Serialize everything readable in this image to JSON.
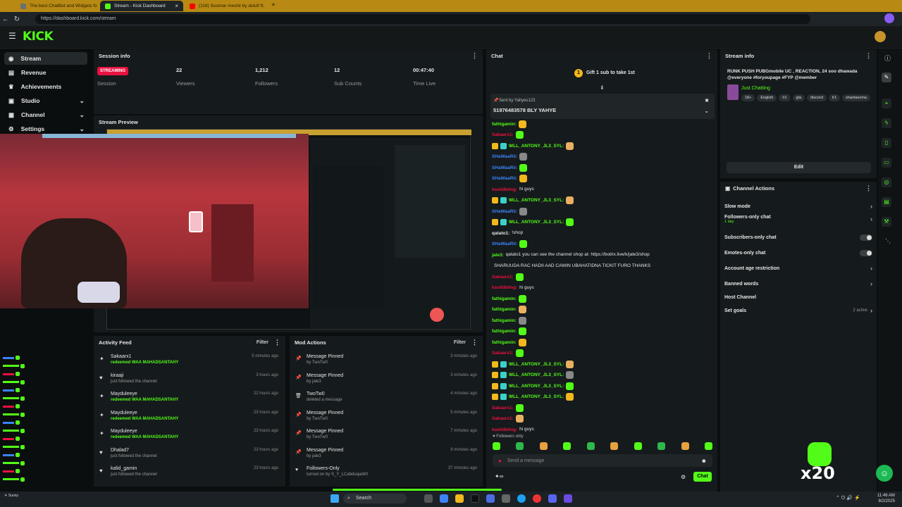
{
  "browser": {
    "tabs": [
      {
        "label": "The best ChatBot and Widgets fo",
        "color": "#6a6f73"
      },
      {
        "label": "Stream - Kick Dashboard",
        "color": "#53fc18"
      },
      {
        "label": "(118) Soomar meshii by dulufi ft.",
        "color": "#ff0000"
      }
    ],
    "url": "https://dashboard.kick.com/stream"
  },
  "app": {
    "logo": "KICK"
  },
  "sidebar": {
    "items": [
      {
        "label": "Stream",
        "icon": "radio-icon"
      },
      {
        "label": "Revenue",
        "icon": "money-icon"
      },
      {
        "label": "Achievements",
        "icon": "trophy-icon"
      },
      {
        "label": "Studio",
        "icon": "studio-icon"
      },
      {
        "label": "Channel",
        "icon": "channel-icon"
      },
      {
        "label": "Settings",
        "icon": "gear-icon"
      }
    ]
  },
  "session": {
    "title": "Session info",
    "status": "STREAMING",
    "status_label": "Session",
    "viewers": "22",
    "viewers_label": "Viewers",
    "followers": "1,212",
    "followers_label": "Followers",
    "subs": "12",
    "subs_label": "Sub Counts",
    "time": "00:47:40",
    "time_label": "Time Live"
  },
  "preview": {
    "title": "Stream Preview"
  },
  "activity": {
    "title": "Activity Feed",
    "filter": "Filter",
    "items": [
      {
        "name": "Sakaarx1",
        "detail": "redeemed WAA MAHADSANTAHY",
        "time": "5 minutes ago",
        "green": true,
        "icon": "gift"
      },
      {
        "name": "kiraaji",
        "detail": "just followed the channel",
        "time": "3 hours ago",
        "green": false,
        "icon": "heart"
      },
      {
        "name": "Mayduleeye",
        "detail": "redeemed WAA MAHADSANTAHY",
        "time": "22 hours ago",
        "green": true,
        "icon": "gift"
      },
      {
        "name": "Mayduleeye",
        "detail": "redeemed WAA MAHADSANTAHY",
        "time": "23 hours ago",
        "green": true,
        "icon": "gift"
      },
      {
        "name": "Mayduleeye",
        "detail": "redeemed WAA MAHADSANTAHY",
        "time": "23 hours ago",
        "green": true,
        "icon": "gift"
      },
      {
        "name": "Dhalad7",
        "detail": "just followed the channel",
        "time": "23 hours ago",
        "green": false,
        "icon": "heart"
      },
      {
        "name": "kalid_gamin",
        "detail": "just followed the channel",
        "time": "23 hours ago",
        "green": false,
        "icon": "heart"
      }
    ]
  },
  "mod": {
    "title": "Mod Actions",
    "filter": "Filter",
    "items": [
      {
        "name": "Message Pinned",
        "detail": "by TwoTw0",
        "time": "3 minutes ago",
        "icon": "pin"
      },
      {
        "name": "Message Pinned",
        "detail": "by jale3",
        "time": "3 minutes ago",
        "icon": "pin"
      },
      {
        "name": "TwoTw0",
        "detail": "deleted a message",
        "time": "4 minutes ago",
        "icon": "trash"
      },
      {
        "name": "Message Pinned",
        "detail": "by TwoTw0",
        "time": "5 minutes ago",
        "icon": "pin"
      },
      {
        "name": "Message Pinned",
        "detail": "by TwoTw0",
        "time": "7 minutes ago",
        "icon": "pin"
      },
      {
        "name": "Message Pinned",
        "detail": "by jale3",
        "time": "9 minutes ago",
        "icon": "pin"
      },
      {
        "name": "Followers-Only",
        "detail": "turned on by S_Y_LCabduqadir0",
        "time": "37 minutes ago",
        "icon": "heart"
      }
    ]
  },
  "chat": {
    "title": "Chat",
    "gift_banner": "Gift 1 sub to take 1st",
    "pinned_by": "Sent by Yahyes123",
    "pinned_msg": "51976483578 BLY YAHYE",
    "followers_only": "Followers only",
    "placeholder": "Send a message",
    "send_label": "Chat",
    "messages": [
      {
        "user": "fathigamin:",
        "color": "#53fc18",
        "text": ""
      },
      {
        "user": "Sakaarx1:",
        "color": "#e8113f",
        "text": ""
      },
      {
        "user": "WLL_ANTONY_JL3_SYL:",
        "color": "#53fc18",
        "text": ""
      },
      {
        "user": "SHaWaaRii:",
        "color": "#3b82f6",
        "text": ""
      },
      {
        "user": "SHaWaaRii:",
        "color": "#3b82f6",
        "text": ""
      },
      {
        "user": "SHaWaaRii:",
        "color": "#3b82f6",
        "text": ""
      },
      {
        "user": "kaslidbling:",
        "color": "#e8113f",
        "text": "hi guys"
      },
      {
        "user": "WLL_ANTONY_JL3_SYL:",
        "color": "#53fc18",
        "text": ""
      },
      {
        "user": "SHaWaaRii:",
        "color": "#3b82f6",
        "text": ""
      },
      {
        "user": "WLL_ANTONY_JL3_SYL:",
        "color": "#53fc18",
        "text": ""
      },
      {
        "user": "qatato1:",
        "color": "#e6e6e6",
        "text": "!shop"
      },
      {
        "user": "SHaWaaRii:",
        "color": "#3b82f6",
        "text": ""
      },
      {
        "user": "jale3:",
        "color": "#53fc18",
        "text": "qatato1 you can see the channel shop at: https://botrix.live/k/jale3/shop"
      },
      {
        "user": "",
        "color": "#e6e6e6",
        "text": "SHARUUDA RAC HADII AAD CAWIN UBAHATIDNA TICKIT FURO THANKS"
      },
      {
        "user": "Sakaarx1:",
        "color": "#e8113f",
        "text": ""
      },
      {
        "user": "kaslidbling:",
        "color": "#e8113f",
        "text": "hi guys"
      },
      {
        "user": "fathigamin:",
        "color": "#53fc18",
        "text": ""
      },
      {
        "user": "fathigamin:",
        "color": "#53fc18",
        "text": ""
      },
      {
        "user": "fathigamin:",
        "color": "#53fc18",
        "text": ""
      },
      {
        "user": "fathigamin:",
        "color": "#53fc18",
        "text": ""
      },
      {
        "user": "fathigamin:",
        "color": "#53fc18",
        "text": ""
      },
      {
        "user": "Sakaarx1:",
        "color": "#e8113f",
        "text": ""
      },
      {
        "user": "WLL_ANTONY_JL3_SYL:",
        "color": "#53fc18",
        "text": ""
      },
      {
        "user": "WLL_ANTONY_JL3_SYL:",
        "color": "#53fc18",
        "text": ""
      },
      {
        "user": "WLL_ANTONY_JL3_SYL:",
        "color": "#53fc18",
        "text": ""
      },
      {
        "user": "WLL_ANTONY_JL3_SYL:",
        "color": "#53fc18",
        "text": ""
      },
      {
        "user": "Sakaarx1:",
        "color": "#e8113f",
        "text": ""
      },
      {
        "user": "Sakaarx1:",
        "color": "#e8113f",
        "text": ""
      },
      {
        "user": "kaslidbling:",
        "color": "#e8113f",
        "text": "hi guys"
      }
    ]
  },
  "stream_info": {
    "title": "Stream info",
    "stream_title": "RUNK PUSH PUBGmobile UC , REACTION, 24 soo dhawada @everyone #foryoupage #FYP @member",
    "category": "Just Chatting",
    "tags": [
      "18+",
      "English",
      "lr1",
      "gta",
      "discord",
      "lr1",
      "shantasoma"
    ],
    "edit": "Edit"
  },
  "channel_actions": {
    "title": "Channel Actions",
    "items": [
      {
        "label": "Slow mode",
        "type": "chev",
        "sub": ""
      },
      {
        "label": "Followers-only chat",
        "type": "chev",
        "sub": "1 day"
      },
      {
        "label": "Subscribers-only chat",
        "type": "toggle",
        "sub": ""
      },
      {
        "label": "Emotes-only chat",
        "type": "toggle",
        "sub": ""
      },
      {
        "label": "Account age restriction",
        "type": "chev",
        "sub": ""
      },
      {
        "label": "Banned words",
        "type": "chev",
        "sub": ""
      },
      {
        "label": "Host Channel",
        "type": "none",
        "sub": ""
      },
      {
        "label": "Set goals",
        "type": "chev",
        "sub": "2 active"
      }
    ]
  },
  "overlay": {
    "multiplier": "x20"
  },
  "taskbar": {
    "search": "Search",
    "time": "11:46 AM",
    "date": "8/2/2025",
    "weather": "Sunny"
  }
}
